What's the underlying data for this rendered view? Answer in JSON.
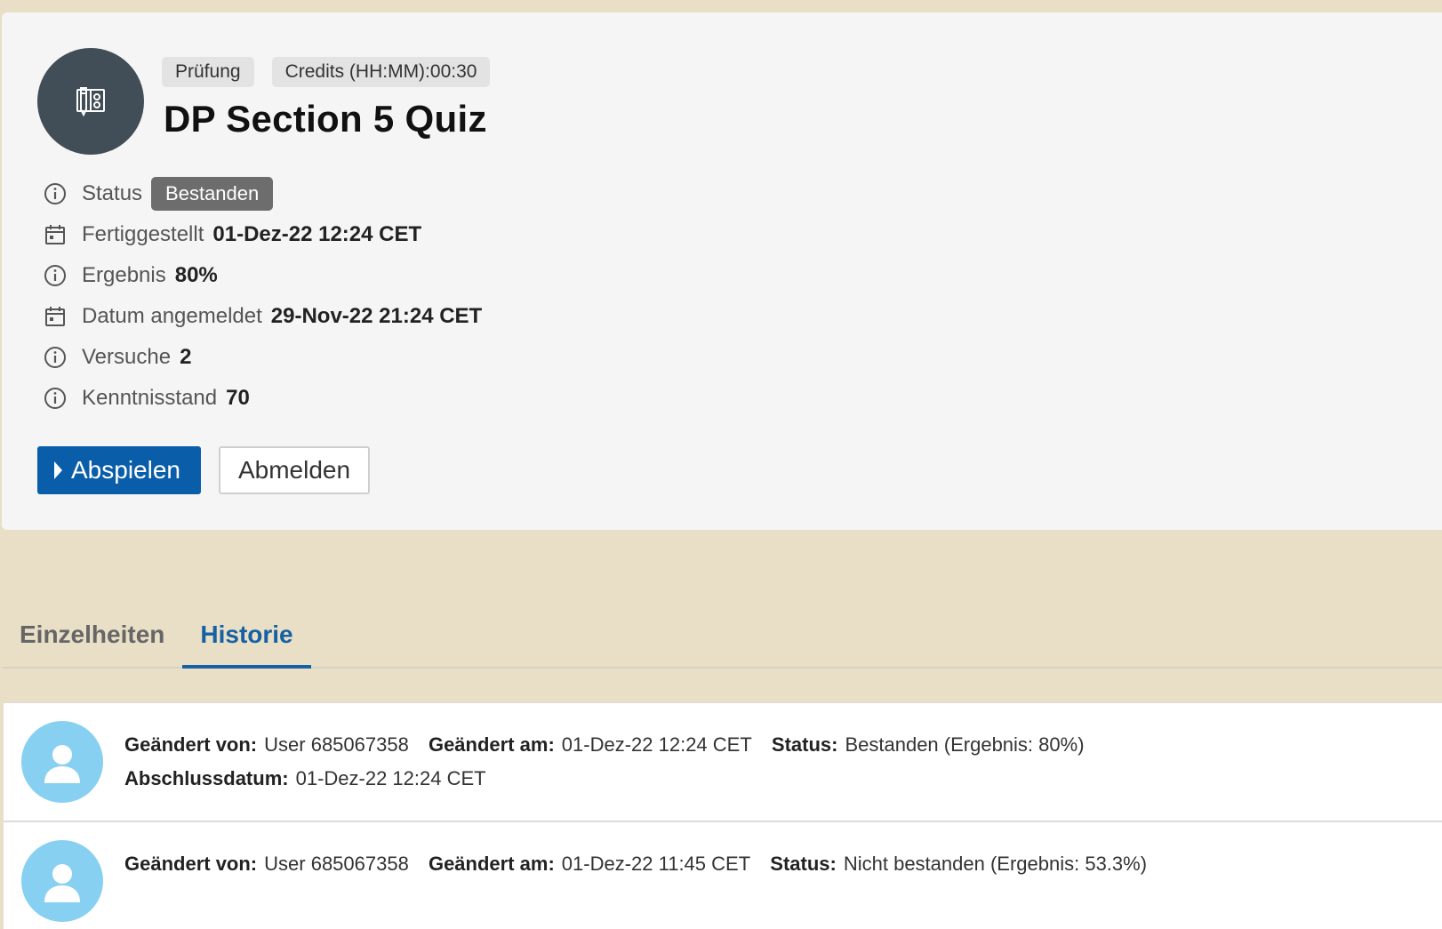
{
  "course": {
    "type_tag": "Prüfung",
    "credits_tag": "Credits (HH:MM):00:30",
    "title": "DP Section 5 Quiz",
    "icon": "quiz-icon"
  },
  "meta": {
    "status_label": "Status",
    "status_value": "Bestanden",
    "completed_label": "Fertiggestellt",
    "completed_value": "01-Dez-22 12:24 CET",
    "score_label": "Ergebnis",
    "score_value": "80%",
    "registered_label": "Datum angemeldet",
    "registered_value": "29-Nov-22 21:24 CET",
    "attempts_label": "Versuche",
    "attempts_value": "2",
    "knowledge_label": "Kenntnisstand",
    "knowledge_value": "70"
  },
  "actions": {
    "play_label": "Abspielen",
    "unregister_label": "Abmelden"
  },
  "tabs": [
    {
      "label": "Einzelheiten",
      "active": false
    },
    {
      "label": "Historie",
      "active": true
    }
  ],
  "history": [
    {
      "changed_by_label": "Geändert von:",
      "changed_by": "User 685067358",
      "changed_at_label": "Geändert am:",
      "changed_at": "01-Dez-22 12:24 CET",
      "status_label": "Status:",
      "status": "Bestanden (Ergebnis: 80%)",
      "completion_label": "Abschlussdatum:",
      "completion": "01-Dez-22 12:24 CET"
    },
    {
      "changed_by_label": "Geändert von:",
      "changed_by": "User 685067358",
      "changed_at_label": "Geändert am:",
      "changed_at": "01-Dez-22 11:45 CET",
      "status_label": "Status:",
      "status": "Nicht bestanden (Ergebnis: 53.3%)"
    }
  ],
  "colors": {
    "page_background": "#e8dfc6",
    "card_background": "#f5f5f5",
    "primary": "#0a5ea9",
    "tab_active": "#1661a4",
    "avatar": "#87d0f2",
    "course_icon_bg": "#414e57",
    "status_badge": "#6d6d6d"
  }
}
